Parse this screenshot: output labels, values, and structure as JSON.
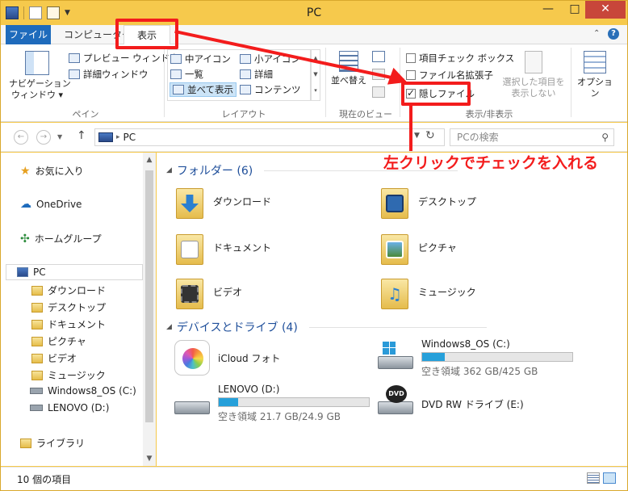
{
  "window": {
    "title": "PC"
  },
  "quick_access": {
    "icons": [
      "pc-icon",
      "properties-icon",
      "new-folder-icon"
    ]
  },
  "window_buttons": {
    "minimize": "—",
    "maximize": "□",
    "close": "✕"
  },
  "ribbon_tabs": {
    "file": "ファイル",
    "computer": "コンピューター",
    "view": "表示"
  },
  "ribbon": {
    "pane": {
      "nav_pane": "ナビゲーション\nウィンドウ ▾",
      "preview": "プレビュー ウィンドウ",
      "details": "詳細ウィンドウ",
      "label": "ペイン"
    },
    "layout": {
      "items": [
        "中アイコン",
        "小アイコン",
        "一覧",
        "詳細",
        "並べて表示",
        "コンテンツ"
      ],
      "selected": "並べて表示",
      "label": "レイアウト"
    },
    "current_view": {
      "sort": "並べ替え",
      "label": "現在のビュー"
    },
    "show_hide": {
      "item_checkbox": "項目チェック ボックス",
      "file_ext": "ファイル名拡張子",
      "hidden_files": "隠しファイル",
      "hide_selected": "選択した項目を\n表示しない",
      "label": "表示/非表示"
    },
    "options": {
      "label": "オプション"
    }
  },
  "address": {
    "path": "PC",
    "search_placeholder": "PCの検索"
  },
  "nav": {
    "favorites": "お気に入り",
    "onedrive": "OneDrive",
    "homegroup": "ホームグループ",
    "pc": "PC",
    "pc_children": [
      "ダウンロード",
      "デスクトップ",
      "ドキュメント",
      "ピクチャ",
      "ビデオ",
      "ミュージック",
      "Windows8_OS (C:)",
      "LENOVO (D:)"
    ],
    "libraries": "ライブラリ"
  },
  "content": {
    "folders_header": "フォルダー (6)",
    "folders": [
      "ダウンロード",
      "デスクトップ",
      "ドキュメント",
      "ピクチャ",
      "ビデオ",
      "ミュージック"
    ],
    "drives_header": "デバイスとドライブ (4)",
    "drives": [
      {
        "name": "iCloud フォト"
      },
      {
        "name": "Windows8_OS (C:)",
        "free": "空き領域 362 GB/425 GB",
        "used_fraction": 0.15
      },
      {
        "name": "LENOVO (D:)",
        "free": "空き領域 21.7 GB/24.9 GB",
        "used_fraction": 0.13
      },
      {
        "name": "DVD RW ドライブ (E:)"
      }
    ]
  },
  "status": {
    "item_count": "10 個の項目"
  },
  "annotation": {
    "text": "左クリックでチェックを入れる"
  },
  "colors": {
    "accent": "#1e6bbc",
    "window_frame": "#f5c84a",
    "annotation": "#f31c1c",
    "drive_bar": "#26a0da"
  }
}
